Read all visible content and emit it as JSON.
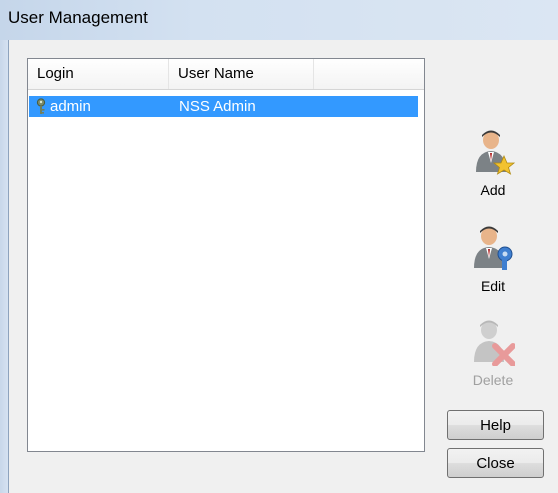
{
  "window": {
    "title": "User Management"
  },
  "list": {
    "columns": [
      "Login",
      "User Name"
    ],
    "rows": [
      {
        "login": "admin",
        "user_name": "NSS Admin",
        "icon": "key-icon",
        "selected": true
      }
    ]
  },
  "actions": {
    "add": {
      "label": "Add",
      "icon": "add-user-icon",
      "enabled": true
    },
    "edit": {
      "label": "Edit",
      "icon": "edit-user-icon",
      "enabled": true
    },
    "delete": {
      "label": "Delete",
      "icon": "delete-user-icon",
      "enabled": false
    }
  },
  "buttons": {
    "help": "Help",
    "close": "Close"
  },
  "colors": {
    "selection": "#3399ff",
    "titlebar": "#d3e1f1"
  }
}
